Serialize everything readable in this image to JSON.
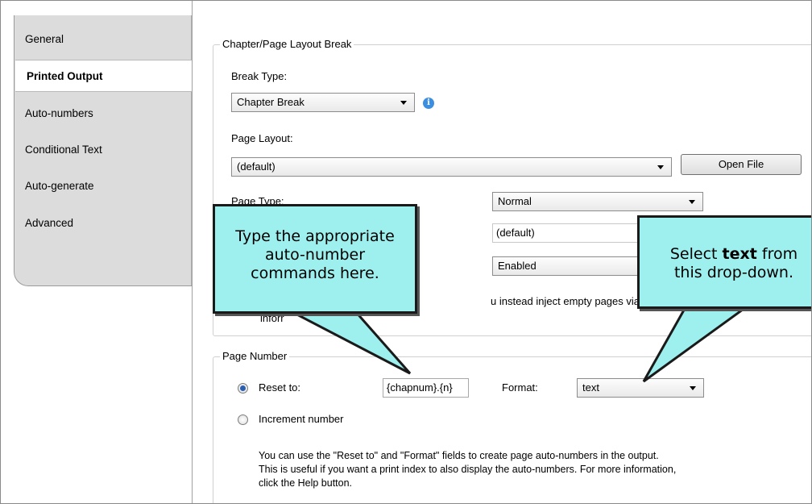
{
  "sidebar": {
    "items": [
      {
        "label": "General"
      },
      {
        "label": "Printed Output"
      },
      {
        "label": "Auto-numbers"
      },
      {
        "label": "Conditional Text"
      },
      {
        "label": "Auto-generate"
      },
      {
        "label": "Advanced"
      }
    ],
    "active_index": 1
  },
  "layout_break": {
    "legend": "Chapter/Page Layout Break",
    "break_type_label": "Break Type:",
    "break_type_value": "Chapter Break",
    "page_layout_label": "Page Layout:",
    "page_layout_value": "(default)",
    "open_file_label": "Open File",
    "page_type_label": "Page Type:",
    "page_type_value": "Normal",
    "second_select_value": "(default)",
    "third_select_value": "Enabled",
    "note_text_a": "u instead inject empty pages via the t",
    "note_text_b": "inforr"
  },
  "page_number": {
    "legend": "Page Number",
    "reset_label": "Reset to:",
    "reset_value": "{chapnum}.{n}",
    "format_label": "Format:",
    "format_value": "text",
    "increment_label": "Increment number",
    "description": [
      "You can use the \"Reset to\" and \"Format\" fields to create page auto-numbers in the output.",
      "This is useful if you want a print index to also display the auto-numbers. For more information,",
      "click the Help button."
    ]
  },
  "callouts": {
    "left": "Type the appropriate auto-number commands here.",
    "right_prefix": "Select ",
    "right_bold": "text",
    "right_suffix": " from this drop-down."
  },
  "colors": {
    "callout_fill": "#9ef0ee",
    "callout_border": "#1a1a1a",
    "radio_dot": "#2a5fb0",
    "info_icon": "#3c8fe0"
  }
}
